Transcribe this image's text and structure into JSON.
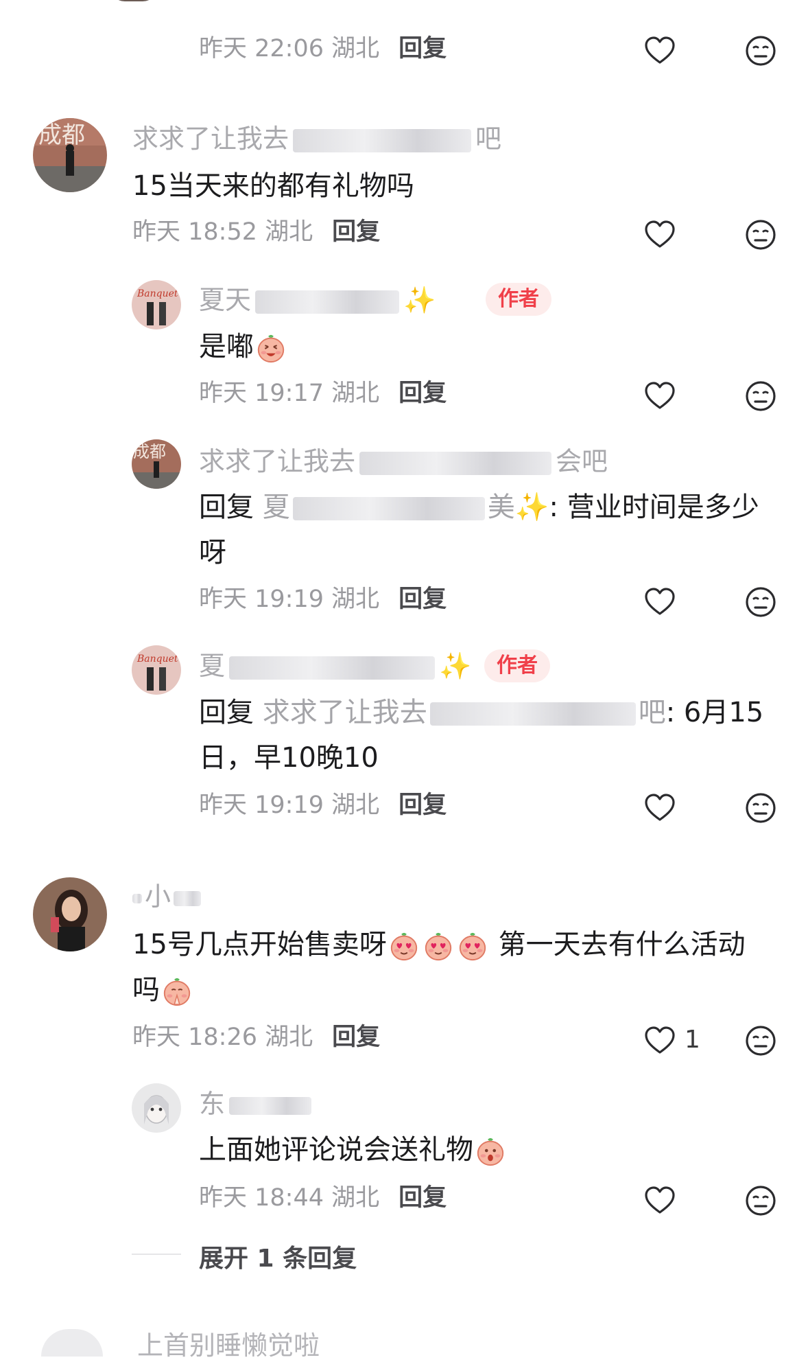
{
  "comments": [
    {
      "time": "昨天 22:06 湖北",
      "reply_label": "回复"
    },
    {
      "user": "求求了让我去",
      "user_suffix": "吧",
      "text": "15当天来的都有礼物吗",
      "time": "昨天 18:52 湖北",
      "reply_label": "回复",
      "replies": [
        {
          "user": "夏天",
          "badge": "作者",
          "text": "是嘟",
          "time": "昨天 19:17 湖北",
          "reply_label": "回复"
        },
        {
          "user": "求求了让我去",
          "user_suffix": "会吧",
          "reply_prefix": "回复",
          "reply_to": "夏",
          "reply_to_suffix": "美",
          "text": ": 营业时间是多少呀",
          "time": "昨天 19:19 湖北",
          "reply_label": "回复"
        },
        {
          "user": "夏",
          "badge": "作者",
          "reply_prefix": "回复",
          "reply_to": "求求了让我去",
          "reply_to_suffix": "吧",
          "text": ": 6月15日，早10晚10",
          "time": "昨天 19:19 湖北",
          "reply_label": "回复"
        }
      ]
    },
    {
      "user": "小",
      "text_part1": "15号几点开始售卖呀",
      "text_part2": " 第一天去有什么活动吗",
      "time": "昨天 18:26 湖北",
      "reply_label": "回复",
      "like_count": "1",
      "replies": [
        {
          "user": "东",
          "text": "上面她评论说会送礼物",
          "time": "昨天 18:44 湖北",
          "reply_label": "回复"
        }
      ],
      "expand_label": "展开 1 条回复"
    },
    {
      "user": "上首别睡懒觉啦"
    }
  ],
  "icons": {
    "like": "heart-outline-icon",
    "dislike": "meh-face-icon",
    "emoji_laugh": "peach-laugh-emoji",
    "emoji_hearts": "peach-heart-eyes-emoji",
    "emoji_pray": "peach-pray-emoji",
    "emoji_shy": "peach-shy-emoji",
    "sparkles": "sparkles-emoji"
  },
  "colors": {
    "author_badge_bg": "#fdeceb",
    "author_badge_text": "#f0404a",
    "meta_text": "#9a9a9e",
    "name_text": "#a9a9ad"
  }
}
